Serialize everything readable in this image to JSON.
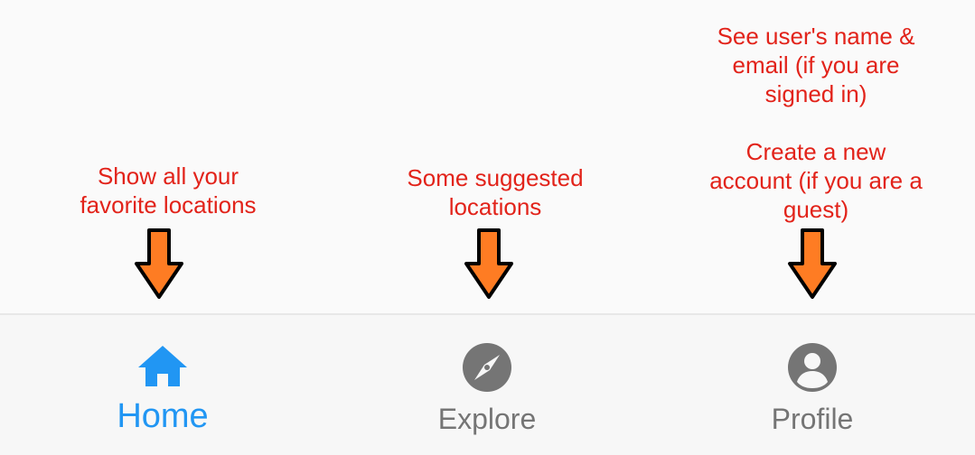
{
  "annotations": {
    "home": {
      "line1": "Show all your",
      "line2": "favorite locations"
    },
    "explore": {
      "line1": "Some suggested",
      "line2": "locations"
    },
    "profile": {
      "line1": "See user's name &",
      "line2": "email (if you are",
      "line3": "signed in)",
      "line4": "Create a new",
      "line5": "account (if you are a",
      "line6": "guest)"
    },
    "color": "#e2231a"
  },
  "arrows": {
    "fill": "#fe7c23",
    "stroke": "#000000"
  },
  "bottom_nav": {
    "items": [
      {
        "label": "Home",
        "icon": "home-icon",
        "active": true
      },
      {
        "label": "Explore",
        "icon": "compass-icon",
        "active": false
      },
      {
        "label": "Profile",
        "icon": "account-circle-icon",
        "active": false
      }
    ],
    "active_color": "#2196f3",
    "inactive_color": "#757575"
  }
}
